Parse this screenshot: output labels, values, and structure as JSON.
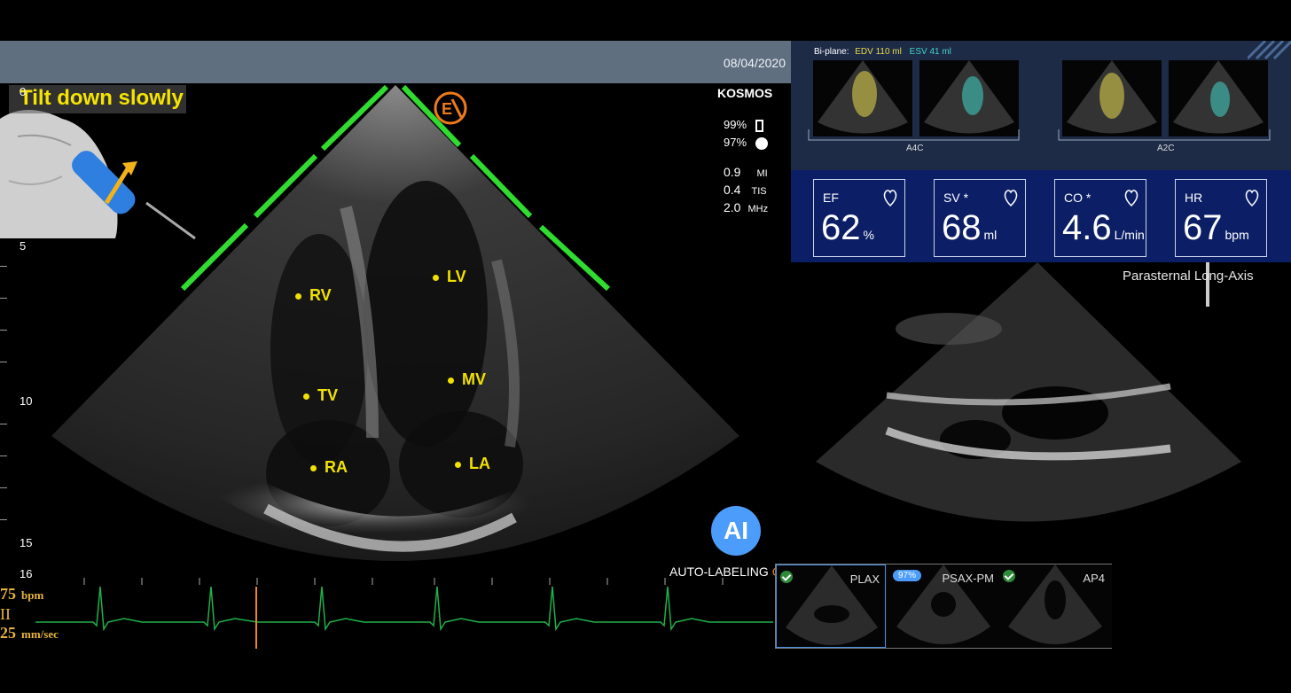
{
  "header": {
    "date": "08/04/2020"
  },
  "instruction": {
    "text": "Tilt down slowly"
  },
  "depth_scale": {
    "labels": [
      "0",
      "5",
      "10",
      "15",
      "16"
    ]
  },
  "device": {
    "brand": "KOSMOS",
    "battery": "99%",
    "signal": "97%",
    "mi_value": "0.9",
    "mi_unit": "MI",
    "tis_value": "0.4",
    "tis_unit": "TIS",
    "freq_value": "2.0",
    "freq_unit": "MHz"
  },
  "structures": [
    "RV",
    "LV",
    "TV",
    "MV",
    "RA",
    "LA"
  ],
  "ecg": {
    "bpm_value": "75",
    "bpm_unit": "bpm",
    "lead": "II",
    "speed_value": "25",
    "speed_unit": "mm/sec"
  },
  "ai": {
    "button": "AI",
    "auto_label": "AUTO-LABELING"
  },
  "biplane": {
    "label": "Bi-plane:",
    "edv": "EDV 110 ml",
    "esv": "ESV 41 ml",
    "view1": "A4C",
    "view2": "A2C",
    "edv_color": "#e8d84a",
    "esv_color": "#3fd6c6"
  },
  "metrics": [
    {
      "title": "EF",
      "value": "62",
      "unit": "%"
    },
    {
      "title": "SV *",
      "value": "68",
      "unit": "ml"
    },
    {
      "title": "CO *",
      "value": "4.6",
      "unit": "L/min"
    },
    {
      "title": "HR",
      "value": "67",
      "unit": "bpm"
    }
  ],
  "secondary_view": {
    "title": "Parasternal Long-Axis"
  },
  "thumbnails": [
    {
      "label": "PLAX",
      "badge": ""
    },
    {
      "label": "PSAX-PM",
      "badge": "97%"
    },
    {
      "label": "AP4",
      "badge": ""
    }
  ],
  "colors": {
    "accent_green": "#2fdc2f",
    "label_yellow": "#f1e100",
    "ecg_green": "#1fb24a",
    "ai_blue": "#4c9dfb"
  }
}
